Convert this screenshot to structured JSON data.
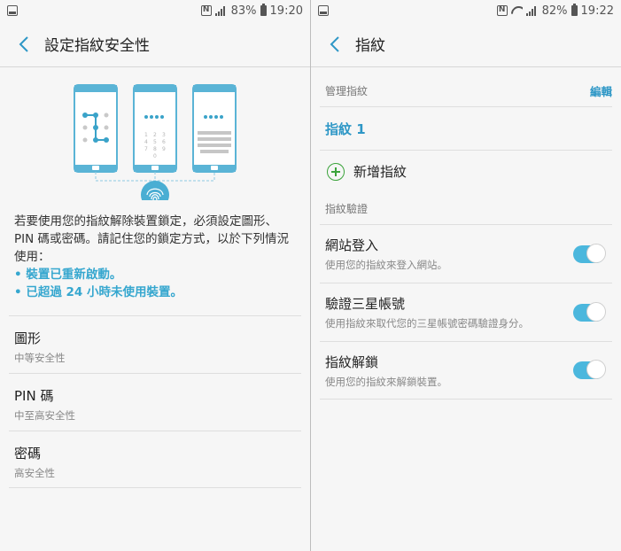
{
  "left": {
    "status": {
      "battery": "83%",
      "time": "19:20"
    },
    "title": "設定指紋安全性",
    "description": "若要使用您的指紋解除裝置鎖定，必須設定圖形、PIN 碼或密碼。請記住您的鎖定方式，以於下列情況使用：",
    "bullets": [
      "• 裝置已重新啟動。",
      "• 已超過 24 小時未使用裝置。"
    ],
    "options": [
      {
        "title": "圖形",
        "subtitle": "中等安全性"
      },
      {
        "title": "PIN 碼",
        "subtitle": "中至高安全性"
      },
      {
        "title": "密碼",
        "subtitle": "高安全性"
      }
    ]
  },
  "right": {
    "status": {
      "battery": "82%",
      "time": "19:22"
    },
    "title": "指紋",
    "manage_header": "管理指紋",
    "edit_label": "編輯",
    "fingerprint_item": "指紋 1",
    "add_label": "新增指紋",
    "verify_header": "指紋驗證",
    "toggles": [
      {
        "title": "網站登入",
        "subtitle": "使用您的指紋來登入網站。",
        "on": true
      },
      {
        "title": "驗證三星帳號",
        "subtitle": "使用指紋來取代您的三星帳號密碼驗證身分。",
        "on": true
      },
      {
        "title": "指紋解鎖",
        "subtitle": "使用您的指紋來解鎖裝置。",
        "on": true
      }
    ]
  },
  "colors": {
    "accent": "#36a7cf",
    "switch_on": "#4bb7dd",
    "plus": "#3ba33b"
  },
  "icons": [
    "gallery-icon",
    "nfc-icon",
    "signal-icon",
    "wifi-icon",
    "battery-icon",
    "back-icon",
    "fingerprint-icon",
    "plus-icon"
  ]
}
